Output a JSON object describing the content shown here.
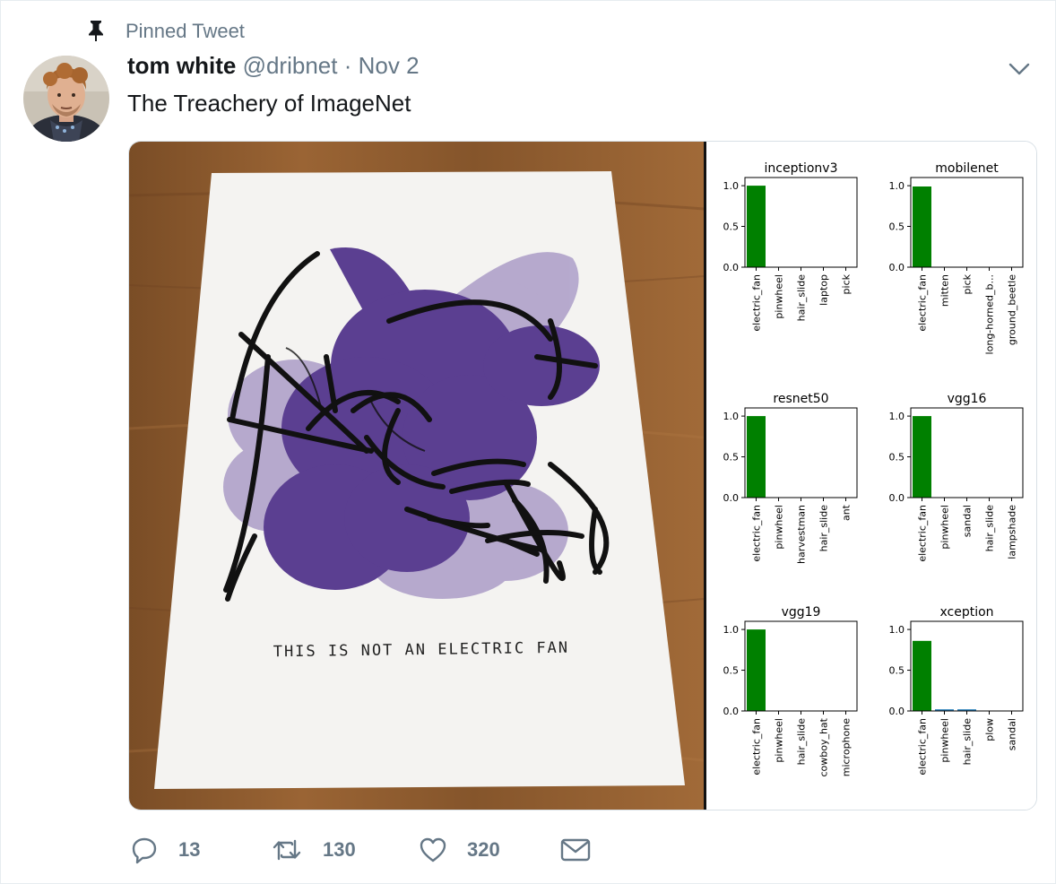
{
  "pinned": {
    "label": "Pinned Tweet",
    "icon": "pin-icon"
  },
  "author": {
    "name": "tom white",
    "handle": "@dribnet",
    "separator": "·",
    "date": "Nov 2"
  },
  "tweet": {
    "text": "The Treachery of ImageNet"
  },
  "artwork": {
    "caption": "THIS IS NOT AN ELECTRIC FAN"
  },
  "actions": {
    "replies": "13",
    "retweets": "130",
    "likes": "320"
  },
  "colors": {
    "bar": "#008000",
    "secondary_bar": "#1f77b4",
    "blob_dark": "#5b3f91",
    "blob_light": "#b3a6cc",
    "table": "#8b5a2b"
  },
  "chart_data": [
    {
      "type": "bar",
      "title": "inceptionv3",
      "categories": [
        "electric_fan",
        "pinwheel",
        "hair_slide",
        "laptop",
        "pick"
      ],
      "values": [
        1.0,
        0,
        0,
        0,
        0
      ],
      "yticks": [
        "0.0",
        "0.5",
        "1.0"
      ],
      "ylim": [
        0,
        1.1
      ]
    },
    {
      "type": "bar",
      "title": "mobilenet",
      "categories": [
        "electric_fan",
        "mitten",
        "pick",
        "long-horned_b...",
        "ground_beetle"
      ],
      "values": [
        0.99,
        0,
        0,
        0,
        0
      ],
      "yticks": [
        "0.0",
        "0.5",
        "1.0"
      ],
      "ylim": [
        0,
        1.1
      ]
    },
    {
      "type": "bar",
      "title": "resnet50",
      "categories": [
        "electric_fan",
        "pinwheel",
        "harvestman",
        "hair_slide",
        "ant"
      ],
      "values": [
        1.0,
        0,
        0,
        0,
        0
      ],
      "yticks": [
        "0.0",
        "0.5",
        "1.0"
      ],
      "ylim": [
        0,
        1.1
      ]
    },
    {
      "type": "bar",
      "title": "vgg16",
      "categories": [
        "electric_fan",
        "pinwheel",
        "sandal",
        "hair_slide",
        "lampshade"
      ],
      "values": [
        1.0,
        0,
        0,
        0,
        0
      ],
      "yticks": [
        "0.0",
        "0.5",
        "1.0"
      ],
      "ylim": [
        0,
        1.1
      ]
    },
    {
      "type": "bar",
      "title": "vgg19",
      "categories": [
        "electric_fan",
        "pinwheel",
        "hair_slide",
        "cowboy_hat",
        "microphone"
      ],
      "values": [
        1.0,
        0,
        0,
        0,
        0
      ],
      "yticks": [
        "0.0",
        "0.5",
        "1.0"
      ],
      "ylim": [
        0,
        1.1
      ]
    },
    {
      "type": "bar",
      "title": "xception",
      "categories": [
        "electric_fan",
        "pinwheel",
        "hair_slide",
        "plow",
        "sandal"
      ],
      "values": [
        0.86,
        0.02,
        0.02,
        0,
        0
      ],
      "yticks": [
        "0.0",
        "0.5",
        "1.0"
      ],
      "ylim": [
        0,
        1.1
      ]
    }
  ]
}
